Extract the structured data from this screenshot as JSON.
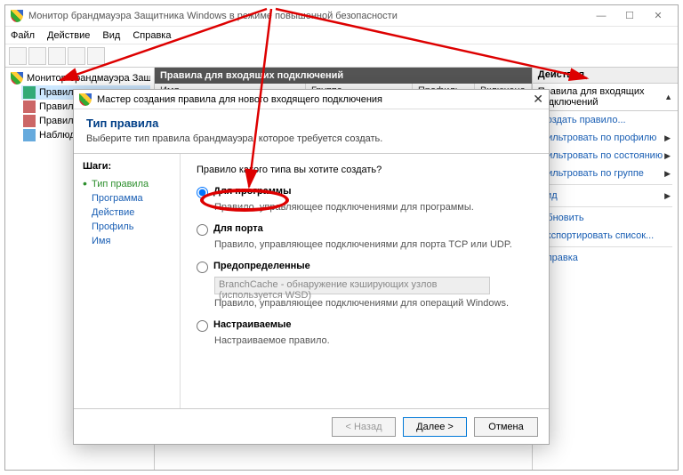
{
  "mainWindow": {
    "title": "Монитор брандмауэра Защитника Windows в режиме повышенной безопасности",
    "menu": {
      "file": "Файл",
      "action": "Действие",
      "view": "Вид",
      "help": "Справка"
    },
    "tree": {
      "root": "Монитор брандмауэра Защи",
      "inbound": "Правила для входящих по",
      "outbound": "Правила для исходящего п",
      "csr": "Правила б",
      "monitoring": "Наблюден"
    },
    "centerHeader": "Правила для входящих подключений",
    "columns": {
      "name": "Имя",
      "group": "Группа",
      "profile": "Профиль",
      "enabled": "Включено"
    },
    "actions": {
      "title": "Действия",
      "section": "Правила для входящих подключений",
      "newRule": "Создать правило...",
      "filterProfile": "Фильтровать по профилю",
      "filterState": "Фильтровать по состоянию",
      "filterGroup": "Фильтровать по группе",
      "view": "Вид",
      "refresh": "Обновить",
      "export": "Экспортировать список...",
      "help": "Справка"
    }
  },
  "wizard": {
    "title": "Мастер создания правила для нового входящего подключения",
    "headerTitle": "Тип правила",
    "headerDesc": "Выберите тип правила брандмауэра, которое требуется создать.",
    "stepsTitle": "Шаги:",
    "steps": {
      "ruleType": "Тип правила",
      "program": "Программа",
      "action": "Действие",
      "profile": "Профиль",
      "name": "Имя"
    },
    "prompt": "Правило какого типа вы хотите создать?",
    "opt1": {
      "label": "Для программы",
      "desc": "Правило, управляющее подключениями для программы."
    },
    "opt2": {
      "label": "Для порта",
      "desc": "Правило, управляющее подключениями для порта TCP или UDP."
    },
    "opt3": {
      "label": "Предопределенные",
      "select": "BranchCache - обнаружение кэширующих узлов (используется WSD)",
      "desc": "Правило, управляющее подключениями для операций Windows."
    },
    "opt4": {
      "label": "Настраиваемые",
      "desc": "Настраиваемое правило."
    },
    "buttons": {
      "back": "< Назад",
      "next": "Далее >",
      "cancel": "Отмена"
    }
  }
}
